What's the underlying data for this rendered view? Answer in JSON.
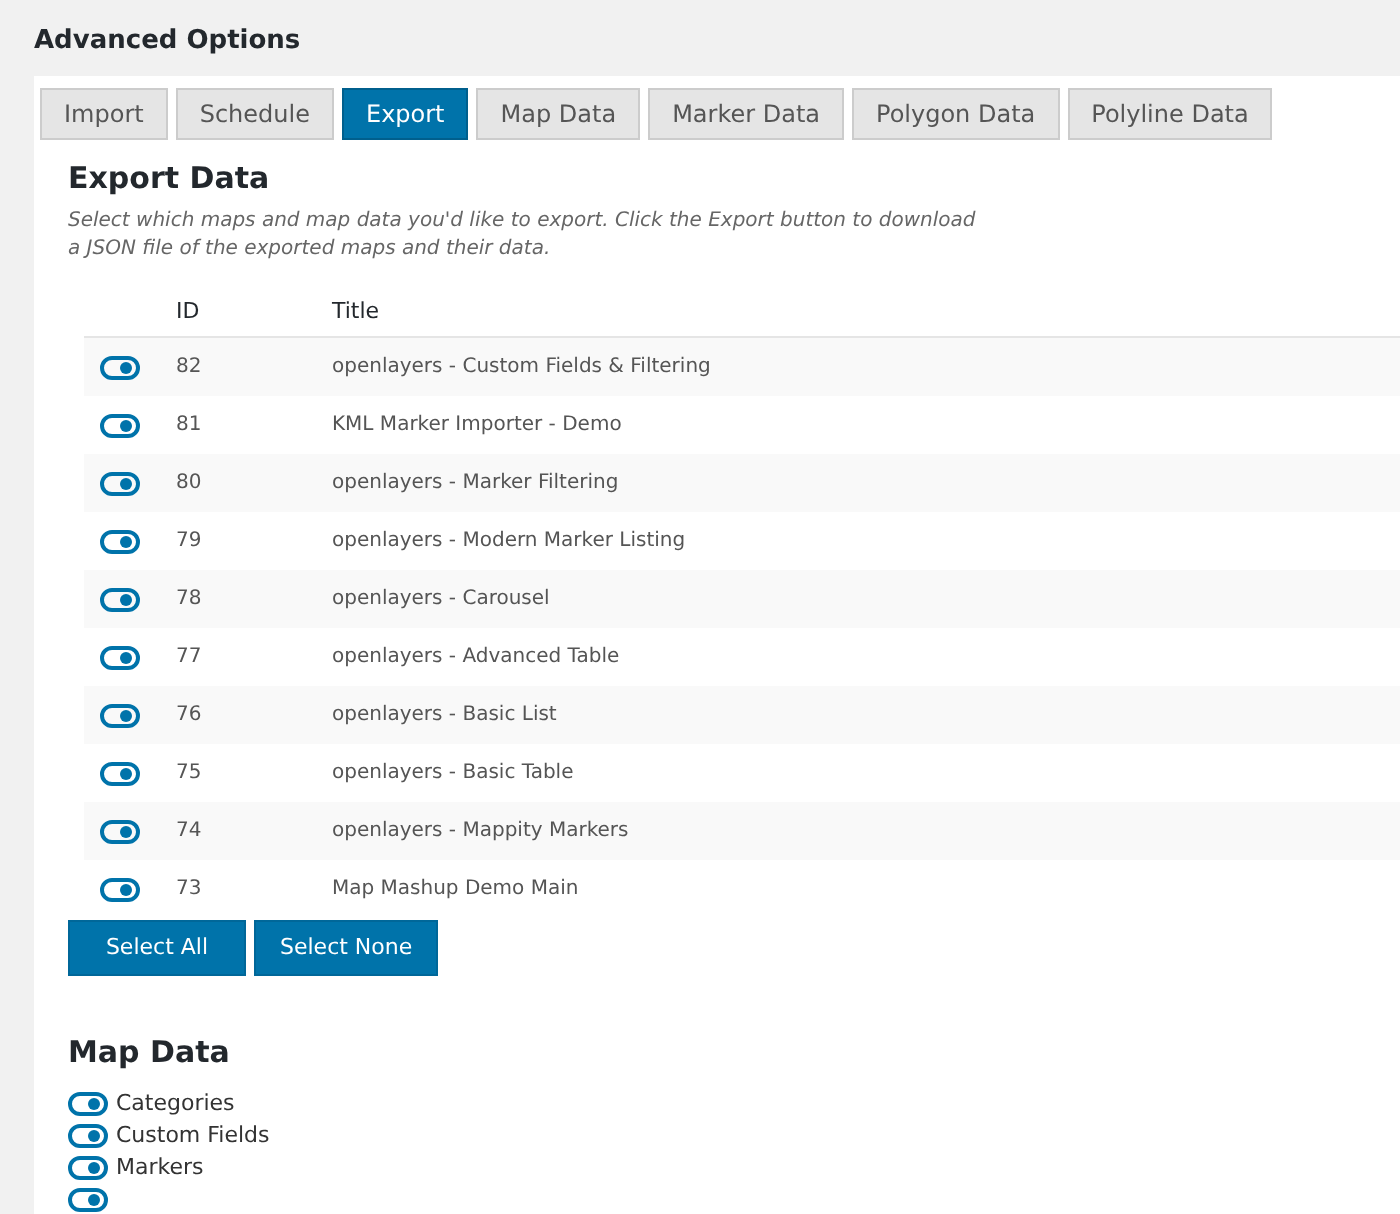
{
  "page_title": "Advanced Options",
  "tabs": [
    {
      "label": "Import",
      "selected": false
    },
    {
      "label": "Schedule",
      "selected": false
    },
    {
      "label": "Export",
      "selected": true
    },
    {
      "label": "Map Data",
      "selected": false
    },
    {
      "label": "Marker Data",
      "selected": false
    },
    {
      "label": "Polygon Data",
      "selected": false
    },
    {
      "label": "Polyline Data",
      "selected": false
    }
  ],
  "export": {
    "heading": "Export Data",
    "description": "Select which maps and map data you'd like to export. Click the Export button to download a JSON file of the exported maps and their data.",
    "columns": [
      "ID",
      "Title"
    ],
    "rows": [
      {
        "id": "82",
        "title": "openlayers - Custom Fields & Filtering",
        "checked": true
      },
      {
        "id": "81",
        "title": "KML Marker Importer - Demo",
        "checked": true
      },
      {
        "id": "80",
        "title": "openlayers - Marker Filtering",
        "checked": true
      },
      {
        "id": "79",
        "title": "openlayers - Modern Marker Listing",
        "checked": true
      },
      {
        "id": "78",
        "title": "openlayers - Carousel",
        "checked": true
      },
      {
        "id": "77",
        "title": "openlayers - Advanced Table",
        "checked": true
      },
      {
        "id": "76",
        "title": "openlayers - Basic List",
        "checked": true
      },
      {
        "id": "75",
        "title": "openlayers - Basic Table",
        "checked": true
      },
      {
        "id": "74",
        "title": "openlayers - Mappity Markers",
        "checked": true
      },
      {
        "id": "73",
        "title": "Map Mashup Demo Main",
        "checked": true
      }
    ],
    "buttons": [
      "Select All",
      "Select None"
    ]
  },
  "map_data": {
    "heading": "Map Data",
    "items": [
      {
        "label": "Categories",
        "checked": true
      },
      {
        "label": "Custom Fields",
        "checked": true
      },
      {
        "label": "Markers",
        "checked": true
      },
      {
        "checked": true
      }
    ]
  }
}
